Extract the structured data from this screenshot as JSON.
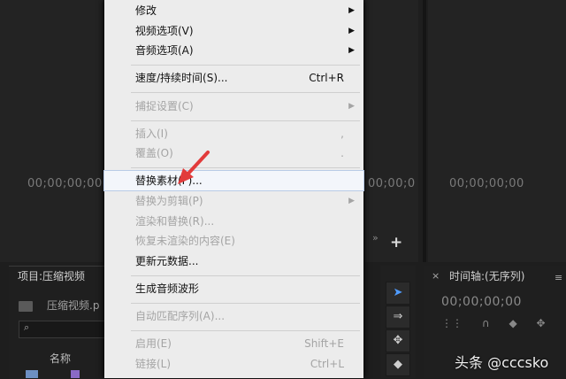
{
  "monitors": {
    "left_timecode": "00;00;00;00",
    "mid_timecode": "00;00;0",
    "right_timecode": "00;00;00;00"
  },
  "project_panel": {
    "title": "项目:压缩视频",
    "item_name": "压缩视频.p",
    "search_placeholder": "",
    "column_name": "名称"
  },
  "timeline_panel": {
    "close": "×",
    "title": "时间轴:(无序列)",
    "timecode": "00;00;00;00"
  },
  "add_button": "+",
  "more_glyph": "»",
  "menu": {
    "items": [
      {
        "label": "修改",
        "shortcut": "",
        "submenu": true,
        "disabled": false
      },
      {
        "label": "视频选项(V)",
        "shortcut": "",
        "submenu": true,
        "disabled": false
      },
      {
        "label": "音频选项(A)",
        "shortcut": "",
        "submenu": true,
        "disabled": false
      },
      {
        "label": "速度/持续时间(S)...",
        "shortcut": "Ctrl+R",
        "submenu": false,
        "disabled": false
      },
      {
        "label": "捕捉设置(C)",
        "shortcut": "",
        "submenu": true,
        "disabled": true
      },
      {
        "label": "插入(I)",
        "shortcut": ",",
        "submenu": false,
        "disabled": true
      },
      {
        "label": "覆盖(O)",
        "shortcut": ".",
        "submenu": false,
        "disabled": true
      },
      {
        "label": "替换素材(F)...",
        "shortcut": "",
        "submenu": false,
        "disabled": false,
        "highlighted": true
      },
      {
        "label": "替换为剪辑(P)",
        "shortcut": "",
        "submenu": true,
        "disabled": true
      },
      {
        "label": "渲染和替换(R)...",
        "shortcut": "",
        "submenu": false,
        "disabled": true
      },
      {
        "label": "恢复未渲染的内容(E)",
        "shortcut": "",
        "submenu": false,
        "disabled": true
      },
      {
        "label": "更新元数据...",
        "shortcut": "",
        "submenu": false,
        "disabled": false
      },
      {
        "label": "生成音频波形",
        "shortcut": "",
        "submenu": false,
        "disabled": false
      },
      {
        "label": "自动匹配序列(A)...",
        "shortcut": "",
        "submenu": false,
        "disabled": true
      },
      {
        "label": "启用(E)",
        "shortcut": "Shift+E",
        "submenu": false,
        "disabled": true
      },
      {
        "label": "链接(L)",
        "shortcut": "Ctrl+L",
        "submenu": false,
        "disabled": true
      }
    ]
  },
  "watermark": "头条 @cccsko",
  "colors": {
    "accent": "#2d8ceb",
    "arrow": "#e23b3b"
  }
}
